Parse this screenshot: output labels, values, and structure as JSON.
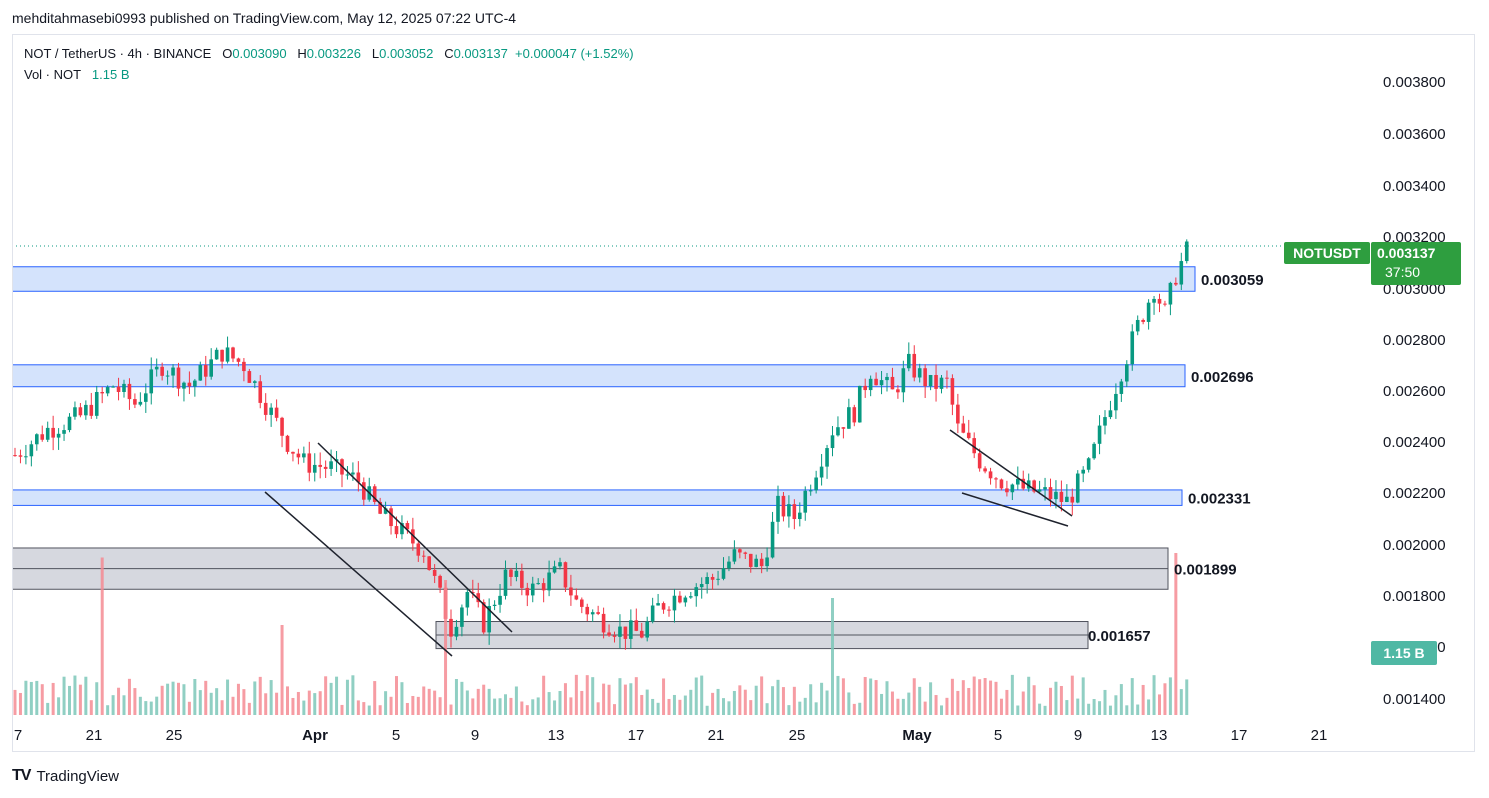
{
  "publisher": "mehditahmasebi0993 published on TradingView.com, May 12, 2025 07:22 UTC-4",
  "legend": {
    "symbol": "NOT / TetherUS · 4h · BINANCE",
    "o_label": "O",
    "o": "0.003090",
    "h_label": "H",
    "h": "0.003226",
    "l_label": "L",
    "l": "0.003052",
    "c_label": "C",
    "c": "0.003137",
    "change": "+0.000047 (+1.52%)",
    "vol_label": "Vol · NOT",
    "vol_value": "1.15 B"
  },
  "price_tag": {
    "symbol": "NOTUSDT",
    "price": "0.003137",
    "countdown": "37:50"
  },
  "vol_tag": "1.15 B",
  "footer": {
    "logo": "TV",
    "brand": "TradingView"
  },
  "colors": {
    "up": "#089981",
    "down": "#f23645",
    "zone_blue": "#cfe0fc",
    "zone_blue_border": "#2962ff",
    "zone_gray": "#d1d4dc",
    "tag_green": "#2e9e3f"
  },
  "chart_data": {
    "type": "candlestick",
    "y_ticks": [
      "0.003800",
      "0.003600",
      "0.003400",
      "0.003200",
      "0.003000",
      "0.002800",
      "0.002600",
      "0.002400",
      "0.002200",
      "0.002000",
      "0.001800",
      "0.001600",
      "0.001400"
    ],
    "x_ticks": [
      "7",
      "21",
      "25",
      "Apr",
      "5",
      "9",
      "13",
      "17",
      "21",
      "25",
      "May",
      "5",
      "9",
      "13",
      "17",
      "21"
    ],
    "ylim": [
      0.00135,
      0.00393
    ],
    "levels": [
      {
        "label": "0.003059",
        "low": 0.002985,
        "high": 0.00308,
        "style": "blue"
      },
      {
        "label": "0.002696",
        "low": 0.002615,
        "high": 0.0027,
        "style": "blue"
      },
      {
        "label": "0.002331",
        "low": 0.002155,
        "high": 0.002215,
        "style": "blue"
      },
      {
        "label": "0.001899",
        "low": 0.00183,
        "high": 0.00199,
        "style": "gray"
      },
      {
        "label": "0.001657",
        "low": 0.0016,
        "high": 0.001705,
        "style": "gray"
      }
    ],
    "current_price": 0.003137,
    "price_path": [
      [
        0,
        0.00235
      ],
      [
        6,
        0.00245
      ],
      [
        12,
        0.0025
      ],
      [
        18,
        0.00262
      ],
      [
        22,
        0.00255
      ],
      [
        27,
        0.0027
      ],
      [
        32,
        0.00262
      ],
      [
        38,
        0.00275
      ],
      [
        42,
        0.0027
      ],
      [
        46,
        0.00255
      ],
      [
        50,
        0.0024
      ],
      [
        53,
        0.00232
      ],
      [
        58,
        0.0023
      ],
      [
        63,
        0.00225
      ],
      [
        67,
        0.00212
      ],
      [
        71,
        0.00205
      ],
      [
        75,
        0.00198
      ],
      [
        78,
        0.0018
      ],
      [
        80,
        0.00168
      ],
      [
        83,
        0.00182
      ],
      [
        86,
        0.0017
      ],
      [
        90,
        0.00188
      ],
      [
        95,
        0.00183
      ],
      [
        100,
        0.0019
      ],
      [
        103,
        0.00178
      ],
      [
        107,
        0.00172
      ],
      [
        111,
        0.00167
      ],
      [
        115,
        0.00166
      ],
      [
        118,
        0.00176
      ],
      [
        123,
        0.00183
      ],
      [
        128,
        0.00187
      ],
      [
        132,
        0.00196
      ],
      [
        137,
        0.00192
      ],
      [
        140,
        0.00215
      ],
      [
        143,
        0.00211
      ],
      [
        146,
        0.00225
      ],
      [
        150,
        0.00245
      ],
      [
        154,
        0.00252
      ],
      [
        157,
        0.00268
      ],
      [
        161,
        0.00259
      ],
      [
        164,
        0.0027
      ],
      [
        168,
        0.00262
      ],
      [
        171,
        0.00263
      ],
      [
        173,
        0.00245
      ],
      [
        177,
        0.00233
      ],
      [
        181,
        0.00225
      ],
      [
        185,
        0.00222
      ],
      [
        189,
        0.0022
      ],
      [
        193,
        0.00217
      ],
      [
        197,
        0.0023
      ],
      [
        200,
        0.0025
      ],
      [
        203,
        0.00268
      ],
      [
        206,
        0.00285
      ],
      [
        209,
        0.003
      ],
      [
        211,
        0.0029
      ],
      [
        213,
        0.00305
      ],
      [
        215,
        0.00314
      ]
    ],
    "volume_spikes": [
      [
        16,
        0.35
      ],
      [
        49,
        0.2
      ],
      [
        79,
        0.3
      ],
      [
        81,
        0.08
      ],
      [
        150,
        0.26
      ],
      [
        213,
        0.36
      ]
    ]
  }
}
